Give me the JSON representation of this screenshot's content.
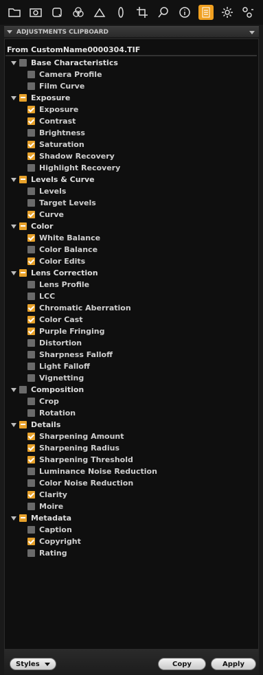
{
  "toolbar": {
    "icons": [
      "folder-icon",
      "camera-icon",
      "capture-icon",
      "color-icon",
      "exposure-icon",
      "lens-icon",
      "crop-icon",
      "loupe-icon",
      "info-icon",
      "clipboard-icon",
      "gear-icon",
      "sliders-icon"
    ],
    "active_icon": "clipboard-icon"
  },
  "panel": {
    "title": "ADJUSTMENTS CLIPBOARD",
    "source": "From CustomName0000304.TIF"
  },
  "groups": [
    {
      "label": "Base Characteristics",
      "state": "unchecked",
      "items": [
        {
          "label": "Camera Profile",
          "checked": false
        },
        {
          "label": "Film Curve",
          "checked": false
        }
      ]
    },
    {
      "label": "Exposure",
      "state": "mixed",
      "items": [
        {
          "label": "Exposure",
          "checked": true
        },
        {
          "label": "Contrast",
          "checked": true
        },
        {
          "label": "Brightness",
          "checked": false
        },
        {
          "label": "Saturation",
          "checked": true
        },
        {
          "label": "Shadow Recovery",
          "checked": true
        },
        {
          "label": "Highlight Recovery",
          "checked": false
        }
      ]
    },
    {
      "label": "Levels & Curve",
      "state": "mixed",
      "items": [
        {
          "label": "Levels",
          "checked": false
        },
        {
          "label": "Target Levels",
          "checked": false
        },
        {
          "label": "Curve",
          "checked": true
        }
      ]
    },
    {
      "label": "Color",
      "state": "mixed",
      "items": [
        {
          "label": "White Balance",
          "checked": true
        },
        {
          "label": "Color Balance",
          "checked": false
        },
        {
          "label": "Color Edits",
          "checked": true
        }
      ]
    },
    {
      "label": "Lens Correction",
      "state": "mixed",
      "items": [
        {
          "label": "Lens Profile",
          "checked": false
        },
        {
          "label": "LCC",
          "checked": false
        },
        {
          "label": "Chromatic Aberration",
          "checked": true
        },
        {
          "label": "Color Cast",
          "checked": true
        },
        {
          "label": "Purple Fringing",
          "checked": true
        },
        {
          "label": "Distortion",
          "checked": false
        },
        {
          "label": "Sharpness Falloff",
          "checked": false
        },
        {
          "label": "Light Falloff",
          "checked": false
        },
        {
          "label": "Vignetting",
          "checked": false
        }
      ]
    },
    {
      "label": "Composition",
      "state": "unchecked",
      "items": [
        {
          "label": "Crop",
          "checked": false
        },
        {
          "label": "Rotation",
          "checked": false
        }
      ]
    },
    {
      "label": "Details",
      "state": "mixed",
      "items": [
        {
          "label": "Sharpening Amount",
          "checked": true
        },
        {
          "label": "Sharpening Radius",
          "checked": true
        },
        {
          "label": "Sharpening Threshold",
          "checked": true
        },
        {
          "label": "Luminance Noise Reduction",
          "checked": false
        },
        {
          "label": "Color Noise Reduction",
          "checked": false
        },
        {
          "label": "Clarity",
          "checked": true
        },
        {
          "label": "Moire",
          "checked": false
        }
      ]
    },
    {
      "label": "Metadata",
      "state": "mixed",
      "items": [
        {
          "label": "Caption",
          "checked": false
        },
        {
          "label": "Copyright",
          "checked": true
        },
        {
          "label": "Rating",
          "checked": false
        }
      ]
    }
  ],
  "footer": {
    "styles_label": "Styles",
    "copy_label": "Copy",
    "apply_label": "Apply"
  },
  "colors": {
    "accent": "#e7a12a",
    "background": "#0f0f0f"
  }
}
